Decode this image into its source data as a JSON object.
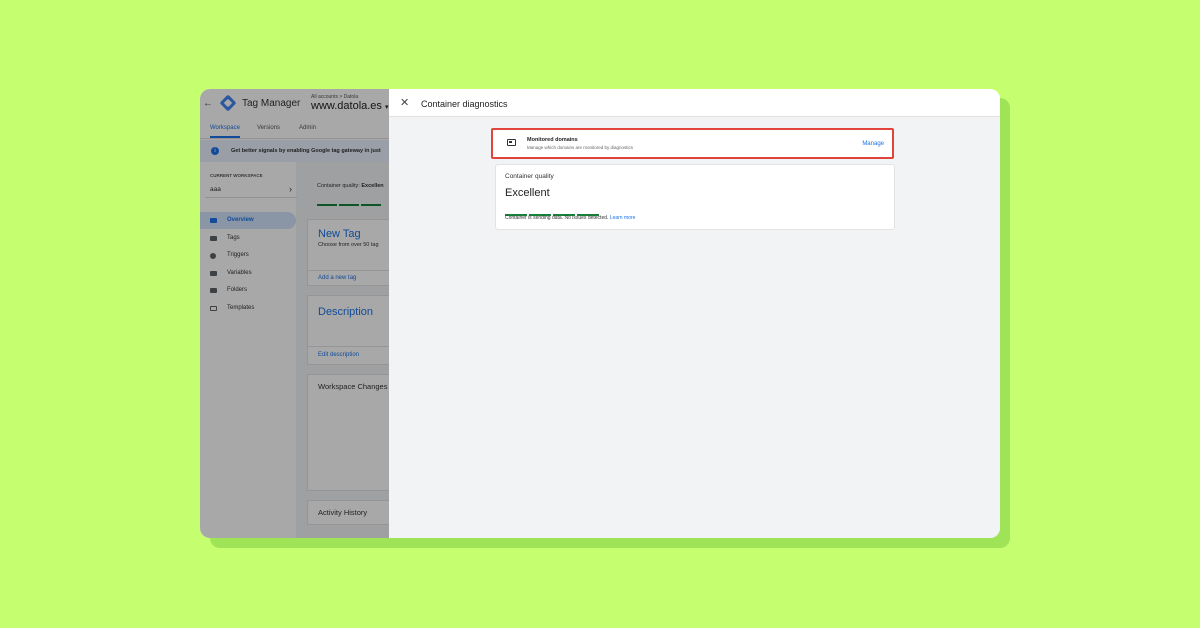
{
  "app": {
    "title": "Tag Manager",
    "breadcrumb": "All accounts > Datola",
    "domain": "www.datola.es",
    "tabs": [
      "Workspace",
      "Versions",
      "Admin"
    ],
    "banner": "Get better signals by enabling Google tag gateway in just",
    "current_workspace_label": "CURRENT WORKSPACE",
    "workspace_name": "aaa",
    "nav": [
      "Overview",
      "Tags",
      "Triggers",
      "Variables",
      "Folders",
      "Templates"
    ],
    "quality_prefix": "Container quality:",
    "quality_value": "Excellen",
    "new_tag": {
      "title": "New Tag",
      "subtitle": "Choose from over 50 tag",
      "link": "Add a new tag"
    },
    "description": {
      "title": "Description",
      "link": "Edit description"
    },
    "workspace_changes": "Workspace Changes",
    "activity_history": "Activity History"
  },
  "panel": {
    "title": "Container diagnostics",
    "monitored": {
      "title": "Monitored domains",
      "subtitle": "Manage which domains are monitored by diagnostics",
      "action": "Manage"
    },
    "quality": {
      "label": "Container quality",
      "value": "Excellent",
      "status": "Container is sending data. No issues detected.",
      "link": "Learn more"
    }
  },
  "colors": {
    "accent": "#1a73e8",
    "quality_bar": "#188038",
    "highlight_border": "#e0443a",
    "background": "#c5ff70"
  }
}
